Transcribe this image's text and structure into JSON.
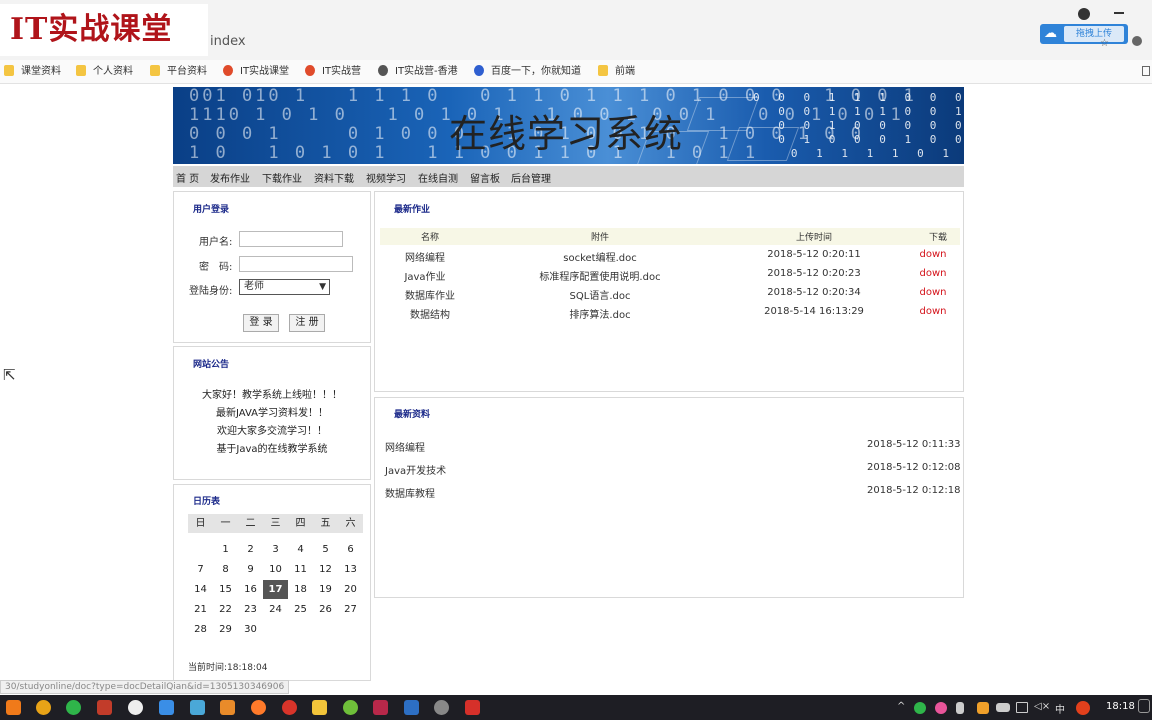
{
  "browser": {
    "logo_text": "IT实战课堂",
    "url": "index",
    "upload_label": "拖拽上传",
    "status_url": "30/studyonline/doc?type=docDetailQian&id=1305130346906"
  },
  "bookmarks": [
    {
      "label": "课堂资料",
      "icon": "folder-icon"
    },
    {
      "label": "个人资料",
      "icon": "folder-icon"
    },
    {
      "label": "平台资料",
      "icon": "folder-icon"
    },
    {
      "label": "IT实战课堂",
      "icon": "site-icon"
    },
    {
      "label": "IT实战营",
      "icon": "site-icon"
    },
    {
      "label": "IT实战营-香港",
      "icon": "globe-icon"
    },
    {
      "label": "百度一下，你就知道",
      "icon": "baidu-paw-icon"
    },
    {
      "label": "前端",
      "icon": "folder-icon"
    }
  ],
  "banner": {
    "title": "在线学习系统"
  },
  "nav": [
    "首 页",
    "发布作业",
    "下载作业",
    "资料下载",
    "视频学习",
    "在线自测",
    "留言板",
    "后台管理"
  ],
  "login": {
    "title": "用户登录",
    "username_label": "用户名:",
    "username_value": "",
    "password_label": "密　码:",
    "password_value": "",
    "role_label": "登陆身份:",
    "role_selected": "老师",
    "login_button": "登 录",
    "register_button": "注 册"
  },
  "notice": {
    "title": "网站公告",
    "items": [
      "大家好！教学系统上线啦！！！",
      "最新JAVA学习资料发！！",
      "欢迎大家多交流学习！！",
      "基于Java的在线教学系统"
    ]
  },
  "calendar": {
    "title": "日历表",
    "weekdays": [
      "日",
      "一",
      "二",
      "三",
      "四",
      "五",
      "六"
    ],
    "start_weekday": 1,
    "days_in_month": 30,
    "today": 17,
    "now_label": "当前时间:18:18:04"
  },
  "homework": {
    "title": "最新作业",
    "columns": [
      "名称",
      "附件",
      "上传时间",
      "下载"
    ],
    "rows": [
      {
        "name": "网络编程",
        "file": "socket编程.doc",
        "time": "2018-5-12 0:20:11",
        "download": "down"
      },
      {
        "name": "Java作业",
        "file": "标准程序配置使用说明.doc",
        "time": "2018-5-12 0:20:23",
        "download": "down"
      },
      {
        "name": "数据库作业",
        "file": "SQL语言.doc",
        "time": "2018-5-12 0:20:34",
        "download": "down"
      },
      {
        "name": "数据结构",
        "file": "排序算法.doc",
        "time": "2018-5-14 16:13:29",
        "download": "down"
      }
    ]
  },
  "materials": {
    "title": "最新资料",
    "rows": [
      {
        "name": "网络编程",
        "time": "2018-5-12 0:11:33"
      },
      {
        "name": "Java开发技术",
        "time": "2018-5-12 0:12:08"
      },
      {
        "name": "数据库教程",
        "time": "2018-5-12 0:12:18"
      }
    ]
  },
  "taskbar": {
    "clock": "18:18",
    "ime": "中"
  }
}
